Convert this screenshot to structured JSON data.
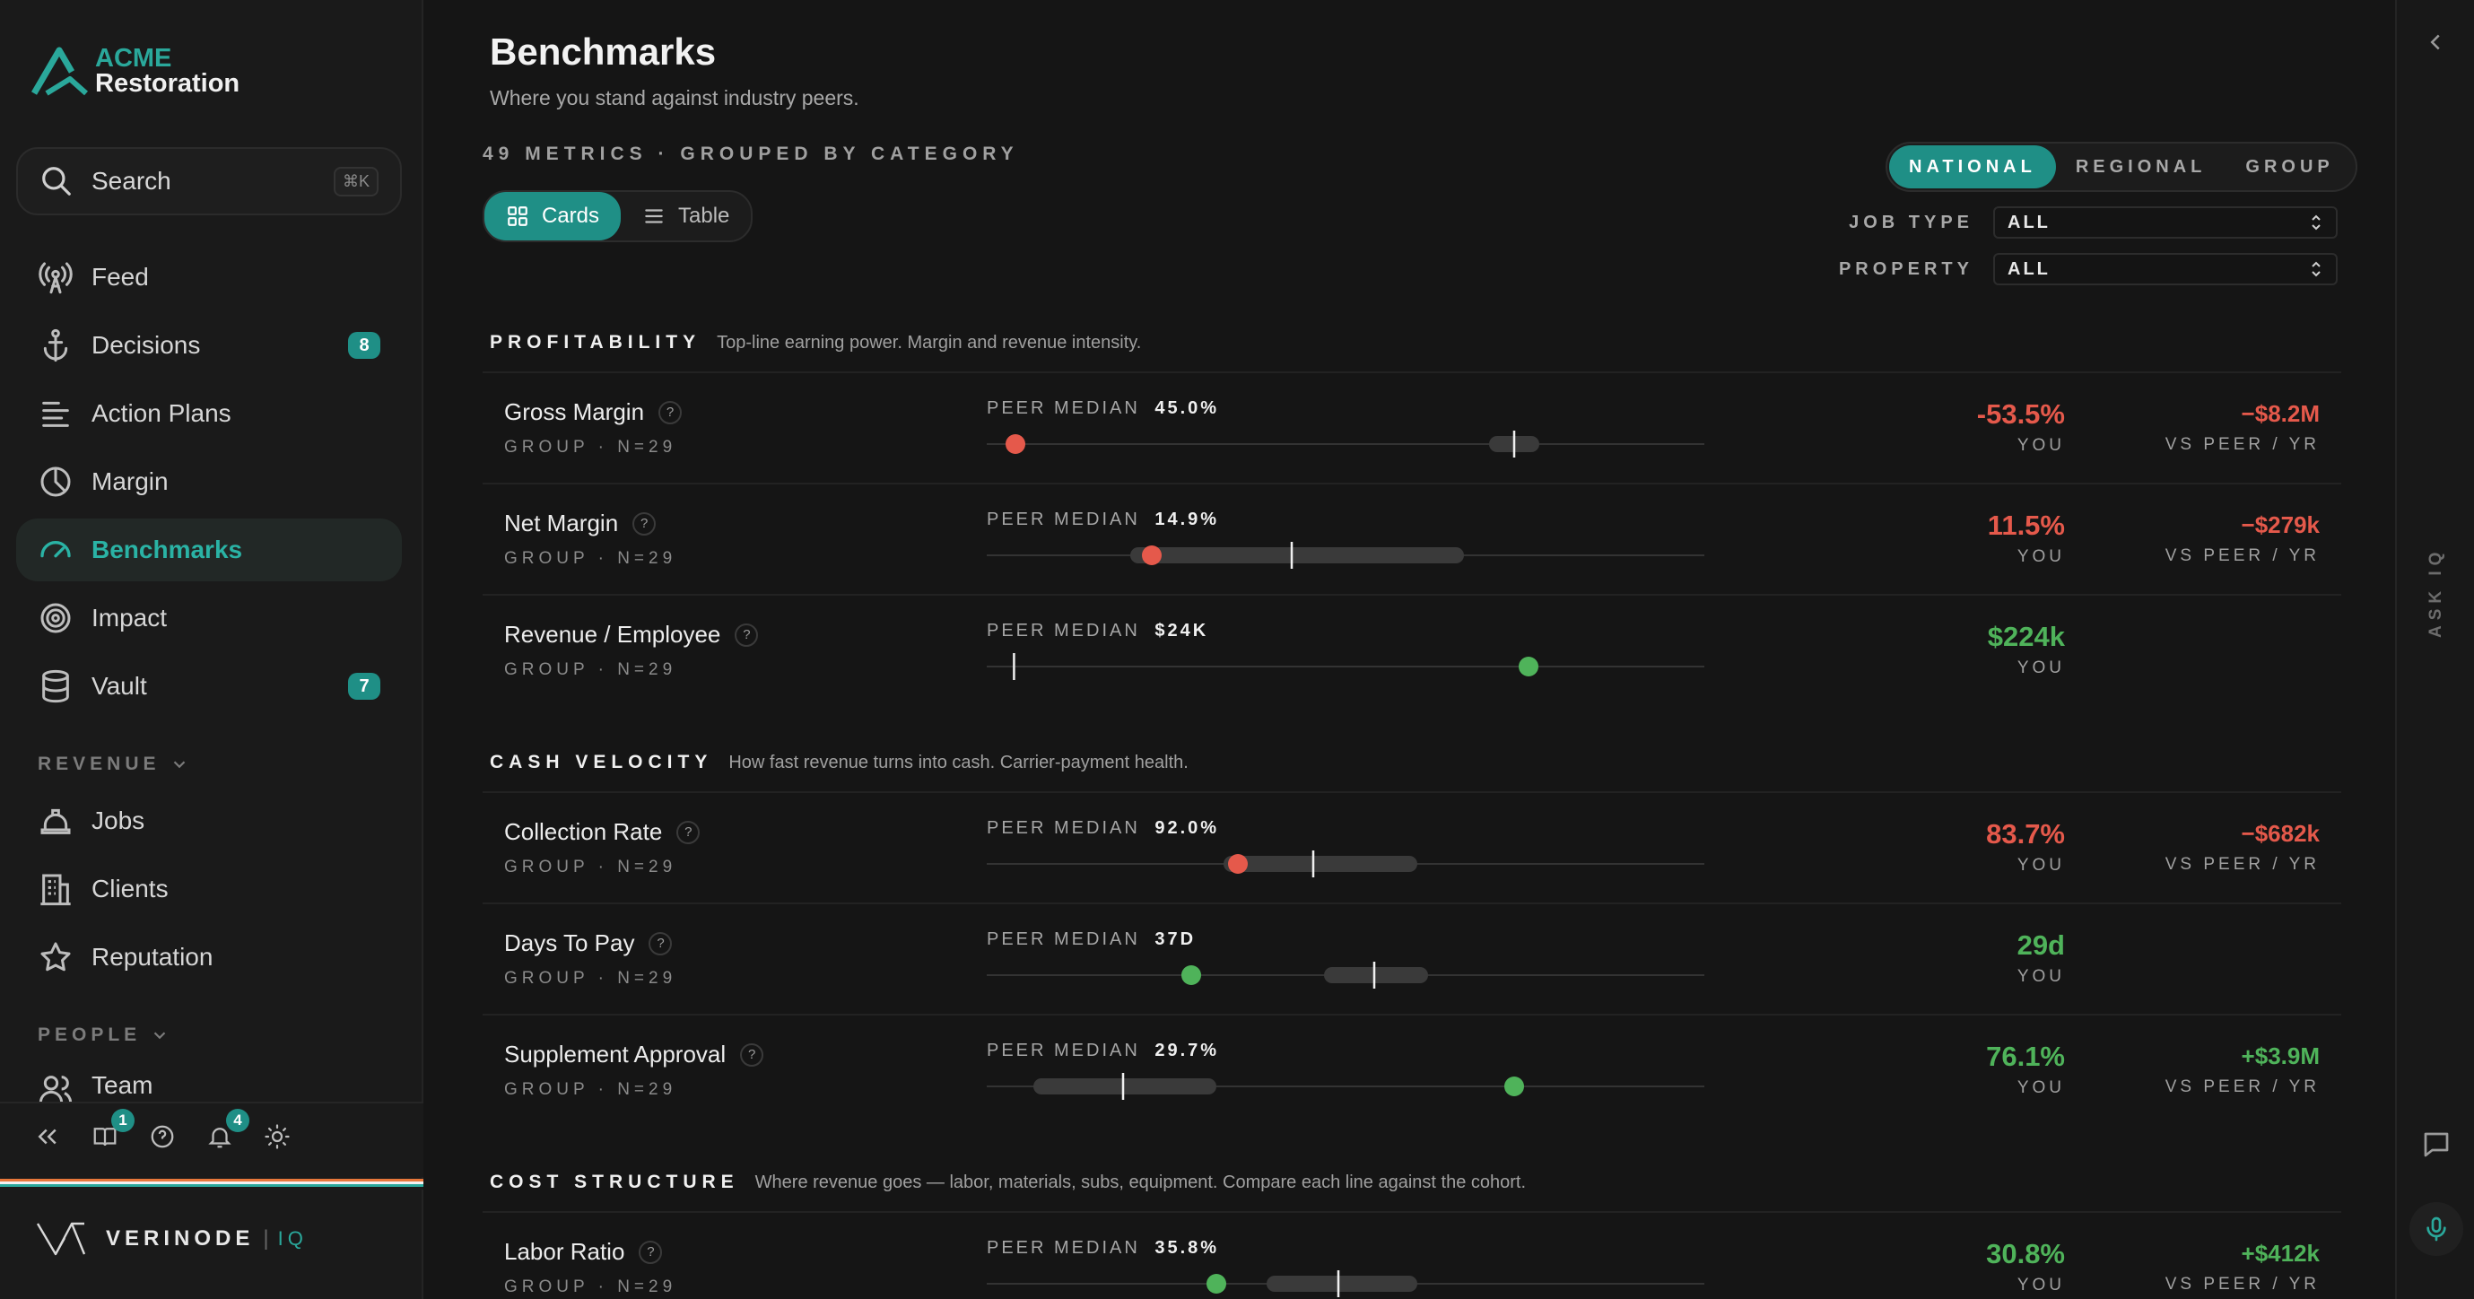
{
  "app": {
    "logo_line1": "ACME",
    "logo_line2": "Restoration"
  },
  "search": {
    "placeholder": "Search",
    "shortcut": "⌘K"
  },
  "nav": [
    {
      "label": "Feed",
      "icon": "broadcast-icon"
    },
    {
      "label": "Decisions",
      "icon": "anchor-icon",
      "badge": "8"
    },
    {
      "label": "Action Plans",
      "icon": "list-icon"
    },
    {
      "label": "Margin",
      "icon": "pie-icon"
    },
    {
      "label": "Benchmarks",
      "icon": "gauge-icon",
      "active": true
    },
    {
      "label": "Impact",
      "icon": "target-icon"
    },
    {
      "label": "Vault",
      "icon": "database-icon",
      "badge": "7"
    }
  ],
  "sections": {
    "revenue": {
      "label": "REVENUE",
      "items": [
        {
          "label": "Jobs",
          "icon": "hardhat-icon"
        },
        {
          "label": "Clients",
          "icon": "building-icon"
        },
        {
          "label": "Reputation",
          "icon": "star-icon"
        }
      ]
    },
    "people": {
      "label": "PEOPLE",
      "items": [
        {
          "label": "Team",
          "icon": "users-icon"
        }
      ]
    }
  },
  "footer": {
    "book_badge": "1",
    "bell_badge": "4"
  },
  "brand": {
    "name": "VERINODE",
    "sep": "|",
    "suffix": "IQ"
  },
  "rail": {
    "ask": "ASK IQ"
  },
  "page": {
    "title": "Benchmarks",
    "subtitle": "Where you stand against industry peers.",
    "metric_count": "49 METRICS · GROUPED BY CATEGORY",
    "views": {
      "cards": "Cards",
      "table": "Table"
    },
    "scope": {
      "national": "NATIONAL",
      "regional": "REGIONAL",
      "group": "GROUP"
    },
    "filters": {
      "job_type": {
        "label": "JOB TYPE",
        "value": "ALL"
      },
      "property": {
        "label": "PROPERTY",
        "value": "ALL"
      }
    }
  },
  "categories": [
    {
      "name": "PROFITABILITY",
      "desc": "Top-line earning power. Margin and revenue intensity."
    },
    {
      "name": "CASH VELOCITY",
      "desc": "How fast revenue turns into cash. Carrier-payment health."
    },
    {
      "name": "COST STRUCTURE",
      "desc": "Where revenue goes — labor, materials, subs, equipment. Compare each line against the cohort."
    }
  ],
  "metrics": [
    {
      "name": "Gross Margin",
      "meta": "GROUP · N=29",
      "peer_label": "PEER MEDIAN",
      "peer_value": "45.0%",
      "you": "-53.5%",
      "you_label": "YOU",
      "you_status": "red",
      "delta": "−$8.2M",
      "delta_label": "VS PEER / YR",
      "delta_status": "red",
      "you_pos": 0.04,
      "median_pos": 0.735,
      "band": [
        0.7,
        0.77
      ]
    },
    {
      "name": "Net Margin",
      "meta": "GROUP · N=29",
      "peer_label": "PEER MEDIAN",
      "peer_value": "14.9%",
      "you": "11.5%",
      "you_label": "YOU",
      "you_status": "red",
      "delta": "−$279k",
      "delta_label": "VS PEER / YR",
      "delta_status": "red",
      "you_pos": 0.23,
      "median_pos": 0.425,
      "band": [
        0.2,
        0.665
      ]
    },
    {
      "name": "Revenue / Employee",
      "meta": "GROUP · N=29",
      "peer_label": "PEER MEDIAN",
      "peer_value": "$24K",
      "you": "$224k",
      "you_label": "YOU",
      "you_status": "green",
      "delta": "",
      "delta_label": "",
      "delta_status": "green",
      "you_pos": 0.755,
      "median_pos": 0.038,
      "band": null
    },
    {
      "name": "Collection Rate",
      "meta": "GROUP · N=29",
      "peer_label": "PEER MEDIAN",
      "peer_value": "92.0%",
      "you": "83.7%",
      "you_label": "YOU",
      "you_status": "red",
      "delta": "−$682k",
      "delta_label": "VS PEER / YR",
      "delta_status": "red",
      "you_pos": 0.35,
      "median_pos": 0.455,
      "band": [
        0.33,
        0.6
      ]
    },
    {
      "name": "Days To Pay",
      "meta": "GROUP · N=29",
      "peer_label": "PEER MEDIAN",
      "peer_value": "37D",
      "you": "29d",
      "you_label": "YOU",
      "you_status": "green",
      "delta": "",
      "delta_label": "",
      "delta_status": "green",
      "you_pos": 0.285,
      "median_pos": 0.54,
      "band": [
        0.47,
        0.615
      ]
    },
    {
      "name": "Supplement Approval",
      "meta": "GROUP · N=29",
      "peer_label": "PEER MEDIAN",
      "peer_value": "29.7%",
      "you": "76.1%",
      "you_label": "YOU",
      "you_status": "green",
      "delta": "+$3.9M",
      "delta_label": "VS PEER / YR",
      "delta_status": "green",
      "you_pos": 0.735,
      "median_pos": 0.19,
      "band": [
        0.065,
        0.32
      ]
    },
    {
      "name": "Labor Ratio",
      "meta": "GROUP · N=29",
      "peer_label": "PEER MEDIAN",
      "peer_value": "35.8%",
      "you": "30.8%",
      "you_label": "YOU",
      "you_status": "green",
      "delta": "+$412k",
      "delta_label": "VS PEER / YR",
      "delta_status": "green",
      "you_pos": 0.32,
      "median_pos": 0.49,
      "band": [
        0.39,
        0.6
      ]
    }
  ],
  "colors": {
    "accent": "#1f8f86",
    "red": "#e5594b",
    "green": "#4fb35a"
  }
}
